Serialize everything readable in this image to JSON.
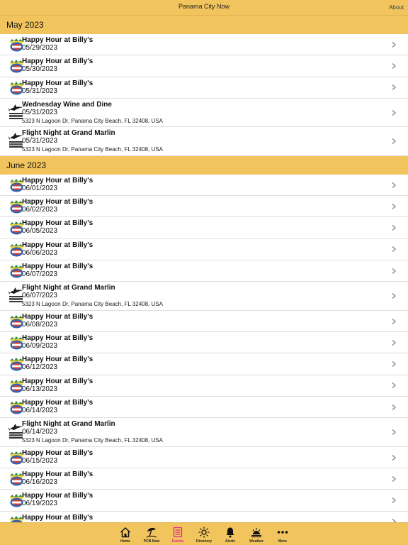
{
  "navbar": {
    "title": "Panama City Now",
    "about_label": "About"
  },
  "sections": [
    {
      "header": "May 2023",
      "rows": [
        {
          "venue": "billys",
          "title": "Happy Hour at Billy's",
          "date": "05/29/2023",
          "address": ""
        },
        {
          "venue": "billys",
          "title": "Happy Hour at Billy's",
          "date": "05/30/2023",
          "address": ""
        },
        {
          "venue": "billys",
          "title": "Happy Hour at Billy's",
          "date": "05/31/2023",
          "address": ""
        },
        {
          "venue": "marlin",
          "title": "Wednesday Wine and Dine",
          "date": "05/31/2023",
          "address": "5323 N Lagoon Dr, Panama City Beach, FL 32408, USA"
        },
        {
          "venue": "marlin",
          "title": "Flight Night at Grand Marlin",
          "date": "05/31/2023",
          "address": "5323 N Lagoon Dr, Panama City Beach, FL 32408, USA"
        }
      ]
    },
    {
      "header": "June 2023",
      "rows": [
        {
          "venue": "billys",
          "title": "Happy Hour at Billy's",
          "date": "06/01/2023",
          "address": ""
        },
        {
          "venue": "billys",
          "title": "Happy Hour at Billy's",
          "date": "06/02/2023",
          "address": ""
        },
        {
          "venue": "billys",
          "title": "Happy Hour at Billy's",
          "date": "06/05/2023",
          "address": ""
        },
        {
          "venue": "billys",
          "title": "Happy Hour at Billy's",
          "date": "06/06/2023",
          "address": ""
        },
        {
          "venue": "billys",
          "title": "Happy Hour at Billy's",
          "date": "06/07/2023",
          "address": ""
        },
        {
          "venue": "marlin",
          "title": "Flight Night at Grand Marlin",
          "date": "06/07/2023",
          "address": "5323 N Lagoon Dr, Panama City Beach, FL 32408, USA"
        },
        {
          "venue": "billys",
          "title": "Happy Hour at Billy's",
          "date": "06/08/2023",
          "address": ""
        },
        {
          "venue": "billys",
          "title": "Happy Hour at Billy's",
          "date": "06/09/2023",
          "address": ""
        },
        {
          "venue": "billys",
          "title": "Happy Hour at Billy's",
          "date": "06/12/2023",
          "address": ""
        },
        {
          "venue": "billys",
          "title": "Happy Hour at Billy's",
          "date": "06/13/2023",
          "address": ""
        },
        {
          "venue": "billys",
          "title": "Happy Hour at Billy's",
          "date": "06/14/2023",
          "address": ""
        },
        {
          "venue": "marlin",
          "title": "Flight Night at Grand Marlin",
          "date": "06/14/2023",
          "address": "5323 N Lagoon Dr, Panama City Beach, FL 32408, USA"
        },
        {
          "venue": "billys",
          "title": "Happy Hour at Billy's",
          "date": "06/15/2023",
          "address": ""
        },
        {
          "venue": "billys",
          "title": "Happy Hour at Billy's",
          "date": "06/16/2023",
          "address": ""
        },
        {
          "venue": "billys",
          "title": "Happy Hour at Billy's",
          "date": "06/19/2023",
          "address": ""
        },
        {
          "venue": "billys",
          "title": "Happy Hour at Billy's",
          "date": "",
          "address": ""
        }
      ]
    }
  ],
  "tabbar": {
    "active_color": "#e0288a",
    "background": "#f1c45d",
    "items": [
      {
        "label": "Home",
        "icon": "home-icon",
        "active": false
      },
      {
        "label": "PCB Now",
        "icon": "beach-umbrella-icon",
        "active": false
      },
      {
        "label": "Events",
        "icon": "calendar-list-icon",
        "active": true
      },
      {
        "label": "Directory",
        "icon": "sun-icon",
        "active": false
      },
      {
        "label": "Alerts",
        "icon": "bell-icon",
        "active": false
      },
      {
        "label": "Weather",
        "icon": "sunrise-icon",
        "active": false
      },
      {
        "label": "More",
        "icon": "more-dots-icon",
        "active": false
      }
    ]
  }
}
